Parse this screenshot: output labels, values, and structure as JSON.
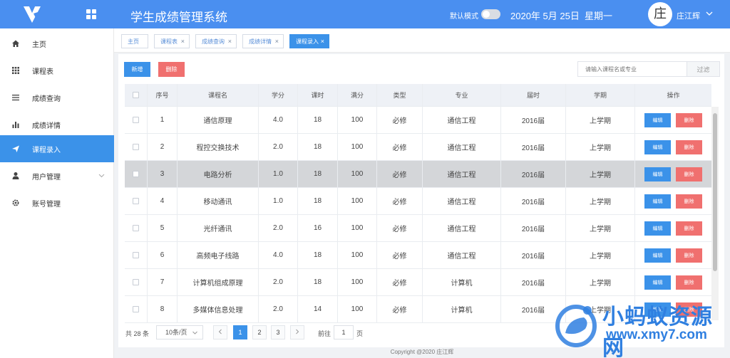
{
  "header": {
    "title": "学生成绩管理系统",
    "mode_label": "默认模式",
    "date": "2020年 5月 25日",
    "weekday": "星期一",
    "avatar_char": "庄",
    "user_name": "庄江辉"
  },
  "sidebar": {
    "items": [
      {
        "label": "主页",
        "icon": "home-icon"
      },
      {
        "label": "课程表",
        "icon": "grid-icon"
      },
      {
        "label": "成绩查询",
        "icon": "list-icon"
      },
      {
        "label": "成绩详情",
        "icon": "bar-chart-icon"
      },
      {
        "label": "课程录入",
        "icon": "send-icon",
        "active": true
      },
      {
        "label": "用户管理",
        "icon": "user-icon"
      },
      {
        "label": "账号管理",
        "icon": "gear-icon"
      }
    ]
  },
  "tabs": [
    {
      "label": "主页",
      "closable": false
    },
    {
      "label": "课程表",
      "closable": true
    },
    {
      "label": "成绩查询",
      "closable": true
    },
    {
      "label": "成绩详情",
      "closable": true
    },
    {
      "label": "课程录入",
      "closable": true,
      "active": true
    }
  ],
  "toolbar": {
    "add_label": "新增",
    "delete_label": "删除",
    "search_placeholder": "请输入课程名或专业",
    "search_button": "过滤"
  },
  "table": {
    "headers": [
      "序号",
      "课程名",
      "学分",
      "课时",
      "满分",
      "类型",
      "专业",
      "届时",
      "学期",
      "操作"
    ],
    "edit_label": "编辑",
    "delete_label": "删除",
    "rows": [
      {
        "no": "1",
        "name": "通信原理",
        "credit": "4.0",
        "hours": "18",
        "full": "100",
        "type": "必修",
        "major": "通信工程",
        "year": "2016届",
        "term": "上学期"
      },
      {
        "no": "2",
        "name": "程控交换技术",
        "credit": "2.0",
        "hours": "18",
        "full": "100",
        "type": "必修",
        "major": "通信工程",
        "year": "2016届",
        "term": "上学期"
      },
      {
        "no": "3",
        "name": "电路分析",
        "credit": "1.0",
        "hours": "18",
        "full": "100",
        "type": "必修",
        "major": "通信工程",
        "year": "2016届",
        "term": "上学期",
        "selected": true
      },
      {
        "no": "4",
        "name": "移动通讯",
        "credit": "1.0",
        "hours": "18",
        "full": "100",
        "type": "必修",
        "major": "通信工程",
        "year": "2016届",
        "term": "上学期"
      },
      {
        "no": "5",
        "name": "光纤通讯",
        "credit": "2.0",
        "hours": "16",
        "full": "100",
        "type": "必修",
        "major": "通信工程",
        "year": "2016届",
        "term": "上学期"
      },
      {
        "no": "6",
        "name": "高频电子线路",
        "credit": "4.0",
        "hours": "18",
        "full": "100",
        "type": "必修",
        "major": "通信工程",
        "year": "2016届",
        "term": "上学期"
      },
      {
        "no": "7",
        "name": "计算机组成原理",
        "credit": "2.0",
        "hours": "18",
        "full": "100",
        "type": "必修",
        "major": "计算机",
        "year": "2016届",
        "term": "上学期"
      },
      {
        "no": "8",
        "name": "多媒体信息处理",
        "credit": "2.0",
        "hours": "14",
        "full": "100",
        "type": "必修",
        "major": "计算机",
        "year": "2016届",
        "term": "上学期"
      }
    ]
  },
  "pagination": {
    "total": "共 28 条",
    "page_size": "10条/页",
    "pages": [
      "1",
      "2",
      "3"
    ],
    "current": "1",
    "goto_label": "前往",
    "goto_value": "1",
    "goto_suffix": "页"
  },
  "footer": {
    "copyright": "Copyright @2020 庄江辉"
  },
  "watermark": {
    "text": "小蚂蚁资源网",
    "url": "www.xmy7.com"
  },
  "colors": {
    "primary": "#4a8ff0",
    "accent": "#3b92e9",
    "danger": "#f0706f"
  }
}
